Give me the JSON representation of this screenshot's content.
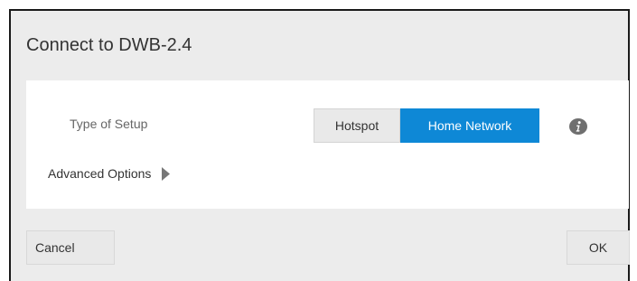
{
  "dialog": {
    "title": "Connect to DWB-2.4"
  },
  "setup": {
    "label": "Type of Setup",
    "options": [
      {
        "label": "Hotspot",
        "selected": false
      },
      {
        "label": "Home Network",
        "selected": true
      }
    ],
    "info_icon": "info-icon"
  },
  "advanced": {
    "label": "Advanced Options",
    "expand_icon": "chevron-right-icon"
  },
  "footer": {
    "cancel_label": "Cancel",
    "ok_label": "OK"
  },
  "colors": {
    "accent": "#0e88d6",
    "dialog_bg": "#ececec",
    "panel_bg": "#ffffff",
    "button_bg": "#e9e9e9",
    "info_icon": "#6f6f6f"
  }
}
